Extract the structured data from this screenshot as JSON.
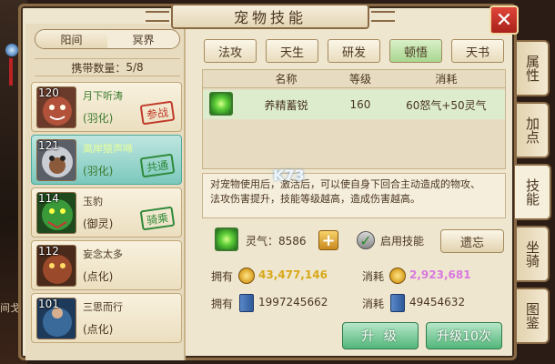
{
  "window": {
    "title": "宠物技能",
    "close_label": "✕"
  },
  "background": {
    "side_text": "间戈"
  },
  "realm_tabs": [
    {
      "label": "阳间"
    },
    {
      "label": "冥界"
    }
  ],
  "carry": {
    "label": "携带数量：",
    "value": "5/8"
  },
  "pets": [
    {
      "level": "120",
      "name": "月下听涛",
      "type": "(羽化)",
      "stamp": "参战",
      "stamp_color": "#c03a2a",
      "avatar_color": "#b2523a"
    },
    {
      "level": "121",
      "name": "离岸猿声啼",
      "type": "(羽化)",
      "stamp": "共通",
      "stamp_color": "#2f8a3a",
      "avatar_color": "#9a9ea8"
    },
    {
      "level": "114",
      "name": "玉豹",
      "type": "(御灵)",
      "stamp": "骑乘",
      "stamp_color": "#2f8a3a",
      "avatar_color": "#3a8a3a"
    },
    {
      "level": "112",
      "name": "妄念太多",
      "type": "(点化)",
      "stamp": "",
      "avatar_color": "#9a4a2a"
    },
    {
      "level": "101",
      "name": "三思而行",
      "type": "(点化)",
      "stamp": "",
      "avatar_color": "#3a6a9a"
    }
  ],
  "side_tabs": [
    {
      "label": "属性"
    },
    {
      "label": "加点"
    },
    {
      "label": "技能"
    },
    {
      "label": "坐骑"
    },
    {
      "label": "图鉴"
    }
  ],
  "skill_tabs": [
    {
      "label": "法攻"
    },
    {
      "label": "天生"
    },
    {
      "label": "研发"
    },
    {
      "label": "顿悟"
    },
    {
      "label": "天书"
    }
  ],
  "table": {
    "headers": [
      "名称",
      "等级",
      "消耗"
    ],
    "rows": [
      {
        "icon": "green-flame-icon",
        "name": "养精蓄锐",
        "level": "160",
        "cost": "60怒气+50灵气"
      }
    ]
  },
  "description": {
    "line1": "对宠物使用后，激活后，可以使自身下回合主动造成的物攻、",
    "line2": "法攻伤害提升，技能等级越高，造成伤害越高。"
  },
  "watermark": "K73",
  "spirit": {
    "label": "灵气：",
    "value": "8586"
  },
  "enable_skill": {
    "label": "启用技能",
    "checked": true
  },
  "forget_button": "遗忘",
  "resources": {
    "owned_label": "拥有",
    "cost_label": "消耗",
    "gold_owned": "43,477,146",
    "gold_cost": "2,923,681",
    "book_owned": "1997245662",
    "book_cost": "49454632"
  },
  "buttons": {
    "upgrade": "升 级",
    "upgrade10": "升级10次"
  },
  "colors": {
    "accent_green": "#52b67a",
    "gold_value": "#d7a91a",
    "pink_value": "#d878e0"
  }
}
